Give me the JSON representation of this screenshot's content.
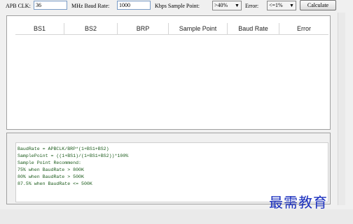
{
  "toolbar": {
    "apb_clk_label": "APB CLK:",
    "apb_clk_value": "36",
    "baud_label": "MHz Baud Rate:",
    "baud_value": "1000",
    "sample_label": "Kbps Sample Point:",
    "sample_value": ">40%",
    "error_label": "Error:",
    "error_value": "<=1%",
    "calculate_label": "Calculate"
  },
  "table": {
    "columns": [
      "BS1",
      "BS2",
      "BRP",
      "Sample Point",
      "Baud Rate",
      "Error"
    ],
    "rows": []
  },
  "info_text": [
    "BaudRate = APBCLK/BRP*(1+BS1+BS2)",
    "SamplePoint = ((1+BS1)/(1+BS1+BS2))*100%",
    "Sample Point Recommend:",
    "75% when BaudRate > 800K",
    "80% when BaudRate > 500K",
    "87.5% when BaudRate <= 500K"
  ],
  "watermark": "最需教育",
  "colors": {
    "text_green": "#1a5a1a",
    "watermark_blue": "#1a2fbe",
    "input_border": "#7a9cc6"
  }
}
